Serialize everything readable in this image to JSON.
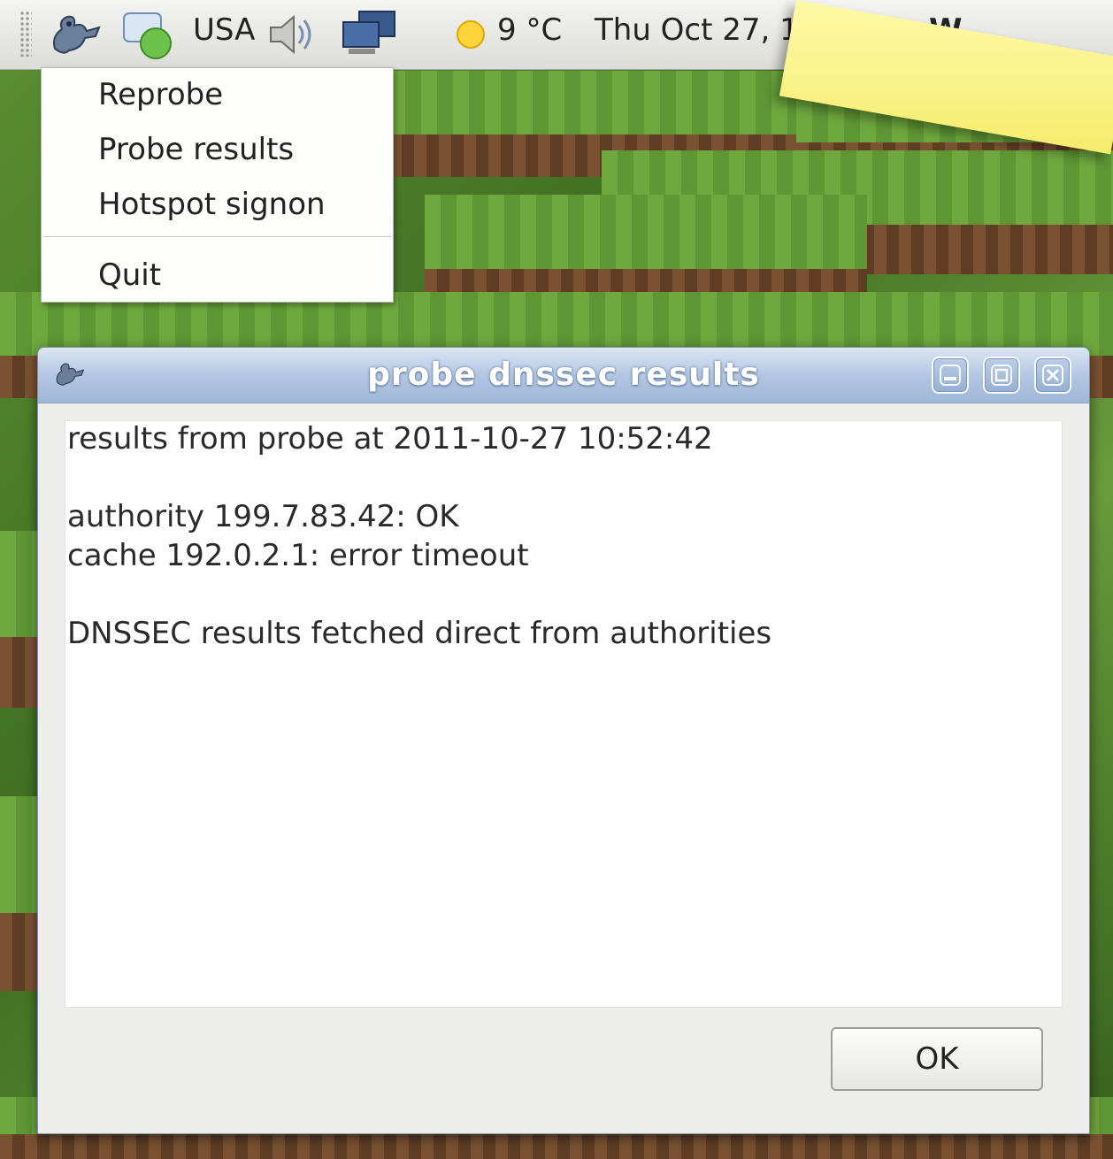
{
  "panel": {
    "keyboard_layout": "USA",
    "temperature": "9 °C",
    "clock": "Thu Oct 27, 10:54",
    "overflow_text": "W",
    "icons": [
      "dnssec-monitor-icon",
      "chat-status-icon",
      "volume-icon",
      "network-icon",
      "weather-sun-icon"
    ]
  },
  "menu": {
    "items": [
      {
        "label": "Reprobe"
      },
      {
        "label": "Probe results"
      },
      {
        "label": "Hotspot signon"
      },
      {
        "label": "Quit"
      }
    ]
  },
  "dialog": {
    "title": "probe dnssec results",
    "lines": [
      "results from probe at 2011-10-27 10:52:42",
      "authority 199.7.83.42: OK",
      "cache 192.0.2.1: error timeout",
      "DNSSEC results fetched direct from authorities"
    ],
    "ok_label": "OK"
  },
  "colors": {
    "titlebar": "#b3c7e2",
    "sticky_note": "#fff9a8",
    "wallpaper_grass": "#6fa83e"
  }
}
